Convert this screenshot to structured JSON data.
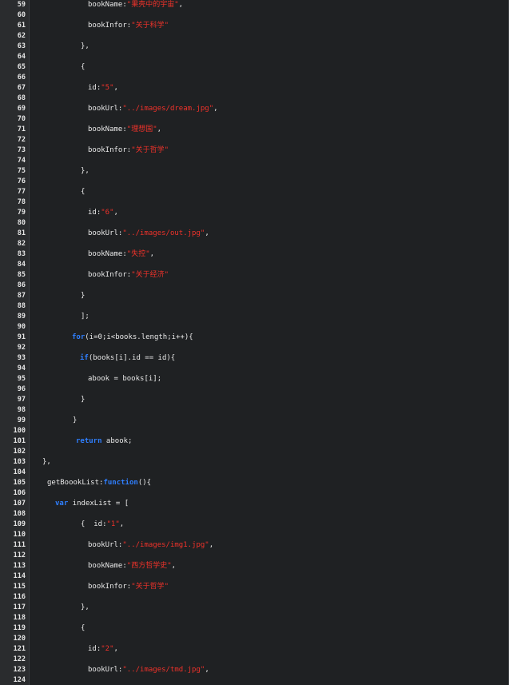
{
  "editor": {
    "colors": {
      "background": "#1f2123",
      "text": "#e8e8e8",
      "keyword": "#2f7fff",
      "string": "#f0322a",
      "gutter": "#2a2c2e"
    },
    "lines": [
      {
        "n": "59",
        "indent": 1,
        "tokens": [
          [
            "",
            "bookName:"
          ],
          [
            "str",
            "\"果壳中的宇宙\""
          ],
          [
            "",
            ","
          ]
        ]
      },
      {
        "n": "60",
        "indent": 0,
        "tokens": []
      },
      {
        "n": "61",
        "indent": 1,
        "tokens": [
          [
            "",
            "bookInfor:"
          ],
          [
            "str",
            "\"关于科学\""
          ]
        ]
      },
      {
        "n": "62",
        "indent": 0,
        "tokens": []
      },
      {
        "n": "63",
        "indent": 2,
        "tokens": [
          [
            "",
            "},"
          ]
        ]
      },
      {
        "n": "64",
        "indent": 0,
        "tokens": []
      },
      {
        "n": "65",
        "indent": 2,
        "tokens": [
          [
            "",
            "{"
          ]
        ]
      },
      {
        "n": "66",
        "indent": 0,
        "tokens": []
      },
      {
        "n": "67",
        "indent": 1,
        "tokens": [
          [
            "",
            "id:"
          ],
          [
            "str",
            "\"5\""
          ],
          [
            "",
            ","
          ]
        ]
      },
      {
        "n": "68",
        "indent": 0,
        "tokens": []
      },
      {
        "n": "69",
        "indent": 1,
        "tokens": [
          [
            "",
            "bookUrl:"
          ],
          [
            "str",
            "\"../images/dream.jpg\""
          ],
          [
            "",
            ","
          ]
        ]
      },
      {
        "n": "70",
        "indent": 0,
        "tokens": []
      },
      {
        "n": "71",
        "indent": 1,
        "tokens": [
          [
            "",
            "bookName:"
          ],
          [
            "str",
            "\"理想国\""
          ],
          [
            "",
            ","
          ]
        ]
      },
      {
        "n": "72",
        "indent": 0,
        "tokens": []
      },
      {
        "n": "73",
        "indent": 1,
        "tokens": [
          [
            "",
            "bookInfor:"
          ],
          [
            "str",
            "\"关于哲学\""
          ]
        ]
      },
      {
        "n": "74",
        "indent": 0,
        "tokens": []
      },
      {
        "n": "75",
        "indent": 2,
        "tokens": [
          [
            "",
            "},"
          ]
        ]
      },
      {
        "n": "76",
        "indent": 0,
        "tokens": []
      },
      {
        "n": "77",
        "indent": 2,
        "tokens": [
          [
            "",
            "{"
          ]
        ]
      },
      {
        "n": "78",
        "indent": 0,
        "tokens": []
      },
      {
        "n": "79",
        "indent": 1,
        "tokens": [
          [
            "",
            "id:"
          ],
          [
            "str",
            "\"6\""
          ],
          [
            "",
            ","
          ]
        ]
      },
      {
        "n": "80",
        "indent": 0,
        "tokens": []
      },
      {
        "n": "81",
        "indent": 1,
        "tokens": [
          [
            "",
            "bookUrl:"
          ],
          [
            "str",
            "\"../images/out.jpg\""
          ],
          [
            "",
            ","
          ]
        ]
      },
      {
        "n": "82",
        "indent": 0,
        "tokens": []
      },
      {
        "n": "83",
        "indent": 1,
        "tokens": [
          [
            "",
            "bookName:"
          ],
          [
            "str",
            "\"失控\""
          ],
          [
            "",
            ","
          ]
        ]
      },
      {
        "n": "84",
        "indent": 0,
        "tokens": []
      },
      {
        "n": "85",
        "indent": 1,
        "tokens": [
          [
            "",
            "bookInfor:"
          ],
          [
            "str",
            "\"关于经济\""
          ]
        ]
      },
      {
        "n": "86",
        "indent": 0,
        "tokens": []
      },
      {
        "n": "87",
        "indent": 2,
        "tokens": [
          [
            "",
            "}"
          ]
        ]
      },
      {
        "n": "88",
        "indent": 0,
        "tokens": []
      },
      {
        "n": "89",
        "indent": 2,
        "tokens": [
          [
            "",
            "];"
          ]
        ]
      },
      {
        "n": "90",
        "indent": 0,
        "tokens": []
      },
      {
        "n": "91",
        "indent": 3,
        "tokens": [
          [
            "kw",
            "for"
          ],
          [
            "",
            "(i=0;i<books.length;i++){"
          ]
        ]
      },
      {
        "n": "92",
        "indent": 0,
        "tokens": []
      },
      {
        "n": "93",
        "indent": 4,
        "tokens": [
          [
            "kw",
            "if"
          ],
          [
            "",
            "(books[i].id == id){"
          ]
        ]
      },
      {
        "n": "94",
        "indent": 0,
        "tokens": []
      },
      {
        "n": "95",
        "indent": 1,
        "tokens": [
          [
            "",
            "abook = books[i];"
          ]
        ]
      },
      {
        "n": "96",
        "indent": 0,
        "tokens": []
      },
      {
        "n": "97",
        "indent": 2,
        "tokens": [
          [
            "",
            "}"
          ]
        ]
      },
      {
        "n": "98",
        "indent": 0,
        "tokens": []
      },
      {
        "n": "99",
        "indent": 5,
        "tokens": [
          [
            "",
            "}"
          ]
        ]
      },
      {
        "n": "100",
        "indent": 0,
        "tokens": []
      },
      {
        "n": "101",
        "indent": 6,
        "tokens": [
          [
            "kw",
            "return"
          ],
          [
            "",
            " abook;"
          ]
        ]
      },
      {
        "n": "102",
        "indent": 0,
        "tokens": []
      },
      {
        "n": "103",
        "indent": 7,
        "tokens": [
          [
            "",
            "},"
          ]
        ]
      },
      {
        "n": "104",
        "indent": 0,
        "tokens": []
      },
      {
        "n": "105",
        "indent": 8,
        "tokens": [
          [
            "",
            "getBoookList:"
          ],
          [
            "kw",
            "function"
          ],
          [
            "",
            "(){"
          ]
        ]
      },
      {
        "n": "106",
        "indent": 0,
        "tokens": []
      },
      {
        "n": "107",
        "indent": 9,
        "tokens": [
          [
            "kw",
            "var"
          ],
          [
            "",
            " indexList = ["
          ]
        ]
      },
      {
        "n": "108",
        "indent": 0,
        "tokens": []
      },
      {
        "n": "109",
        "indent": 2,
        "tokens": [
          [
            "",
            "{  id:"
          ],
          [
            "str",
            "\"1\""
          ],
          [
            "",
            ","
          ]
        ]
      },
      {
        "n": "110",
        "indent": 0,
        "tokens": []
      },
      {
        "n": "111",
        "indent": 1,
        "tokens": [
          [
            "",
            "bookUrl:"
          ],
          [
            "str",
            "\"../images/img1.jpg\""
          ],
          [
            "",
            ","
          ]
        ]
      },
      {
        "n": "112",
        "indent": 0,
        "tokens": []
      },
      {
        "n": "113",
        "indent": 1,
        "tokens": [
          [
            "",
            "bookName:"
          ],
          [
            "str",
            "\"西方哲学史\""
          ],
          [
            "",
            ","
          ]
        ]
      },
      {
        "n": "114",
        "indent": 0,
        "tokens": []
      },
      {
        "n": "115",
        "indent": 1,
        "tokens": [
          [
            "",
            "bookInfor:"
          ],
          [
            "str",
            "\"关于哲学\""
          ]
        ]
      },
      {
        "n": "116",
        "indent": 0,
        "tokens": []
      },
      {
        "n": "117",
        "indent": 2,
        "tokens": [
          [
            "",
            "},"
          ]
        ]
      },
      {
        "n": "118",
        "indent": 0,
        "tokens": []
      },
      {
        "n": "119",
        "indent": 2,
        "tokens": [
          [
            "",
            "{"
          ]
        ]
      },
      {
        "n": "120",
        "indent": 0,
        "tokens": []
      },
      {
        "n": "121",
        "indent": 1,
        "tokens": [
          [
            "",
            "id:"
          ],
          [
            "str",
            "\"2\""
          ],
          [
            "",
            ","
          ]
        ]
      },
      {
        "n": "122",
        "indent": 0,
        "tokens": []
      },
      {
        "n": "123",
        "indent": 1,
        "tokens": [
          [
            "",
            "bookUrl:"
          ],
          [
            "str",
            "\"../images/tmd.jpg\""
          ],
          [
            "",
            ","
          ]
        ]
      },
      {
        "n": "124",
        "indent": 0,
        "tokens": []
      }
    ]
  }
}
